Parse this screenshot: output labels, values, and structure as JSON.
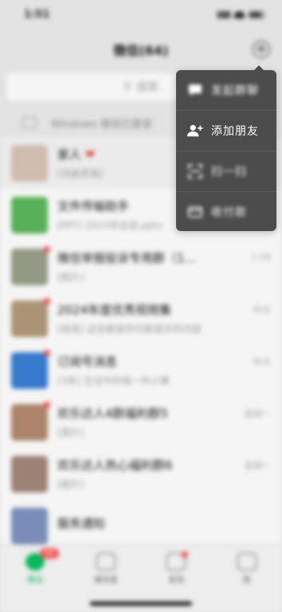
{
  "status": {
    "time": "1:51"
  },
  "nav": {
    "title": "微信(64)"
  },
  "search": {
    "placeholder": "搜索"
  },
  "pc_bar": {
    "text": "Windows 微信已登录"
  },
  "chats": [
    {
      "name": "家人",
      "preview": "[动画表情]",
      "time": "",
      "avatar_color": "#d9c3b7",
      "dot": false,
      "pinned": true,
      "heart": true
    },
    {
      "name": "文件传输助手",
      "preview": "[PPT] 2023年总结.pptx",
      "time": "",
      "avatar_color": "#5cb85c",
      "dot": false,
      "pinned": false,
      "heart": false
    },
    {
      "name": "微信举报投诉专用群（1…",
      "preview": "[图片]",
      "time": "1:48",
      "avatar_color": "#9aa08a",
      "dot": true,
      "pinned": false,
      "heart": false
    },
    {
      "name": "2024年度优秀视频集",
      "preview": "[链接] 这些都是你可能喜欢的内容",
      "time": "昨天",
      "avatar_color": "#b39a7a",
      "dot": true,
      "pinned": false,
      "heart": false
    },
    {
      "name": "订阅号消息",
      "preview": "[3条] 生活中的每一件小事",
      "time": "昨天",
      "avatar_color": "#3a7fd5",
      "dot": true,
      "pinned": false,
      "heart": false
    },
    {
      "name": "欢乐达人4群福利群5",
      "preview": "[图片]",
      "time": "星期一",
      "avatar_color": "#b48a6f",
      "dot": true,
      "pinned": false,
      "heart": false
    },
    {
      "name": "欢乐达人热心福利群6",
      "preview": "[图片]",
      "time": "星期一",
      "avatar_color": "#a3887a",
      "dot": false,
      "pinned": false,
      "heart": false
    },
    {
      "name": "服务通知",
      "preview": "",
      "time": "",
      "avatar_color": "#7f93c2",
      "dot": false,
      "pinned": false,
      "heart": false
    }
  ],
  "menu": {
    "items": [
      {
        "label": "发起群聊",
        "icon": "chat-bubble-icon"
      },
      {
        "label": "添加朋友",
        "icon": "add-friend-icon"
      },
      {
        "label": "扫一扫",
        "icon": "scan-icon"
      },
      {
        "label": "收付款",
        "icon": "pay-icon"
      }
    ]
  },
  "tabs": [
    {
      "label": "微信",
      "badge": "64",
      "active": true
    },
    {
      "label": "通讯录",
      "badge": "",
      "active": false
    },
    {
      "label": "发现",
      "badge": "dot",
      "active": false
    },
    {
      "label": "我",
      "badge": "",
      "active": false
    }
  ],
  "colors": {
    "accent": "#07c160",
    "badge": "#fa5151",
    "menu_bg": "#4c4c4c",
    "bg": "#ededed"
  }
}
